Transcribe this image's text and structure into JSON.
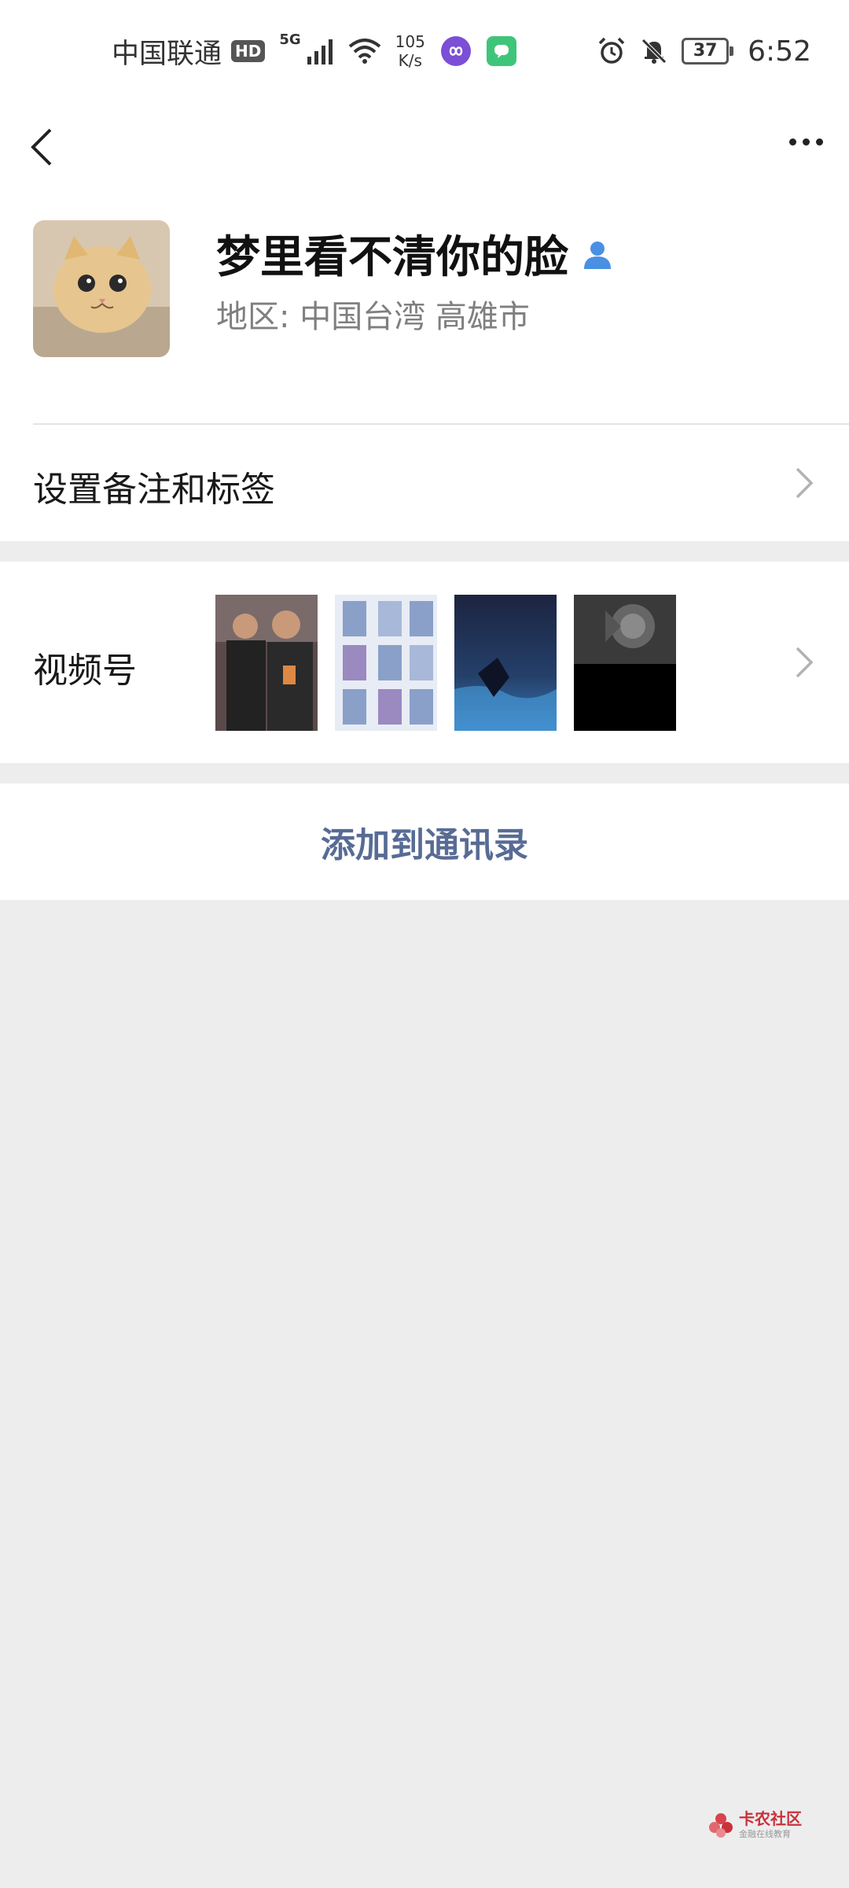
{
  "status_bar": {
    "carrier": "中国联通",
    "hd_badge": "HD",
    "network": "5G",
    "speed_value": "105",
    "speed_unit": "K/s",
    "battery": "37",
    "time": "6:52"
  },
  "nav": {
    "back_icon": "chevron-left-icon",
    "more_icon": "ellipsis-icon"
  },
  "profile": {
    "display_name": "梦里看不清你的脸",
    "region": "地区:  中国台湾  高雄市",
    "verified_icon": "person-icon"
  },
  "rows": {
    "remark_label": "设置备注和标签",
    "channels_label": "视频号"
  },
  "actions": {
    "add_contact": "添加到通讯录"
  },
  "watermark": {
    "main": "卡农社区",
    "sub": "金融在线教育"
  },
  "colors": {
    "link_blue": "#576b95",
    "background_gray": "#ededed",
    "verified_blue": "#4a90e2"
  }
}
